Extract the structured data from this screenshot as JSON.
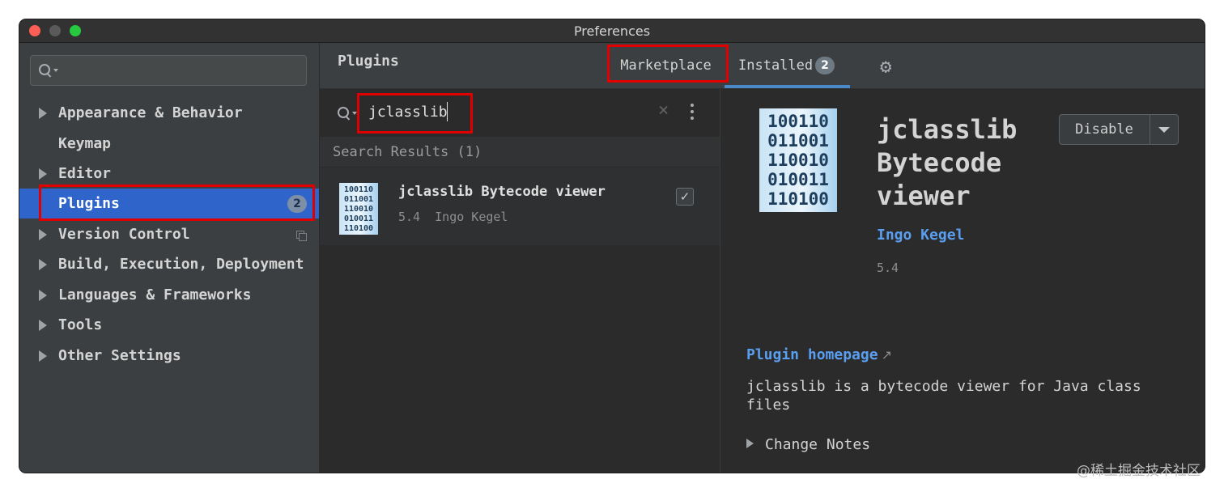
{
  "window": {
    "title": "Preferences"
  },
  "sidebar": {
    "search_placeholder": "",
    "items": [
      {
        "label": "Appearance & Behavior",
        "expandable": true
      },
      {
        "label": "Keymap",
        "expandable": false
      },
      {
        "label": "Editor",
        "expandable": true
      },
      {
        "label": "Plugins",
        "expandable": false,
        "selected": true,
        "badge": "2"
      },
      {
        "label": "Version Control",
        "expandable": true
      },
      {
        "label": "Build, Execution, Deployment",
        "expandable": true
      },
      {
        "label": "Languages & Frameworks",
        "expandable": true
      },
      {
        "label": "Tools",
        "expandable": true
      },
      {
        "label": "Other Settings",
        "expandable": true
      }
    ]
  },
  "plugins": {
    "title": "Plugins",
    "tabs": [
      {
        "label": "Marketplace",
        "active": false
      },
      {
        "label": "Installed",
        "active": true,
        "badge": "2"
      }
    ],
    "search_value": "jclasslib",
    "results_header": "Search Results (1)",
    "results": [
      {
        "name": "jclasslib Bytecode viewer",
        "version": "5.4",
        "vendor": "Ingo Kegel",
        "checked": true
      }
    ]
  },
  "detail": {
    "icon_lines": [
      "100110",
      "011001",
      "110010",
      "010011",
      "110100"
    ],
    "name_lines": [
      "jclasslib",
      "Bytecode",
      "viewer"
    ],
    "vendor": "Ingo Kegel",
    "version": "5.4",
    "disable_label": "Disable",
    "homepage_label": "Plugin homepage",
    "homepage_ext": "↗",
    "description": "jclasslib is a bytecode viewer for Java class files",
    "change_notes_label": "Change Notes"
  },
  "icons": {
    "gear": "gear-icon",
    "search": "search-icon",
    "clear": "close-icon",
    "more": "kebab-menu-icon",
    "copy": "copy-icon"
  },
  "colors": {
    "accent": "#2f65ca",
    "link": "#5a9ef0",
    "highlight": "#e00000"
  },
  "watermark": "@稀土掘金技术社区"
}
